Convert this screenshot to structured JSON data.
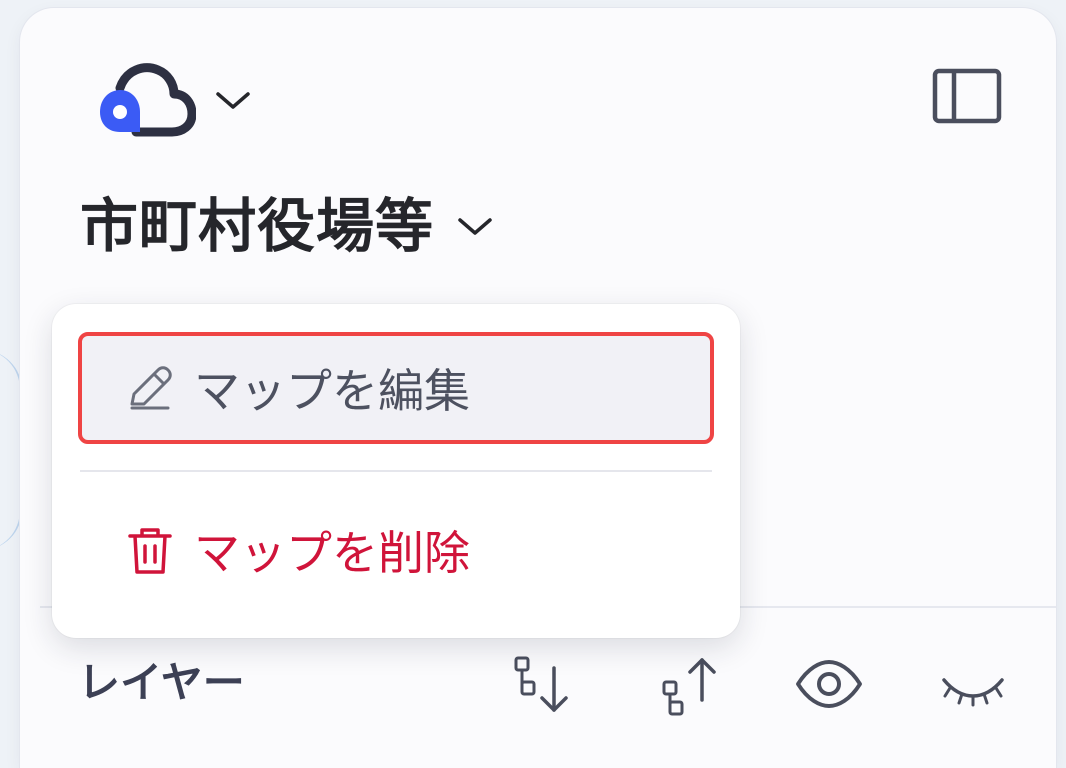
{
  "header": {
    "logo_icon": "cloud-pin-icon",
    "sidebar_toggle_icon": "sidebar-panel-icon"
  },
  "map": {
    "title": "市町村役場等"
  },
  "menu": {
    "items": [
      {
        "label": "マップを編集",
        "icon": "pencil-icon",
        "color": "#4d5160",
        "highlighted": true
      },
      {
        "label": "マップを削除",
        "icon": "trash-icon",
        "color": "#d0143a"
      }
    ]
  },
  "layers": {
    "title": "レイヤー",
    "actions": [
      "sort-descending-icon",
      "sort-ascending-icon",
      "eye-icon",
      "eye-closed-icon"
    ]
  },
  "colors": {
    "accent_blue": "#3b5bf5",
    "danger": "#d0143a",
    "highlight_border": "#ef4444"
  }
}
